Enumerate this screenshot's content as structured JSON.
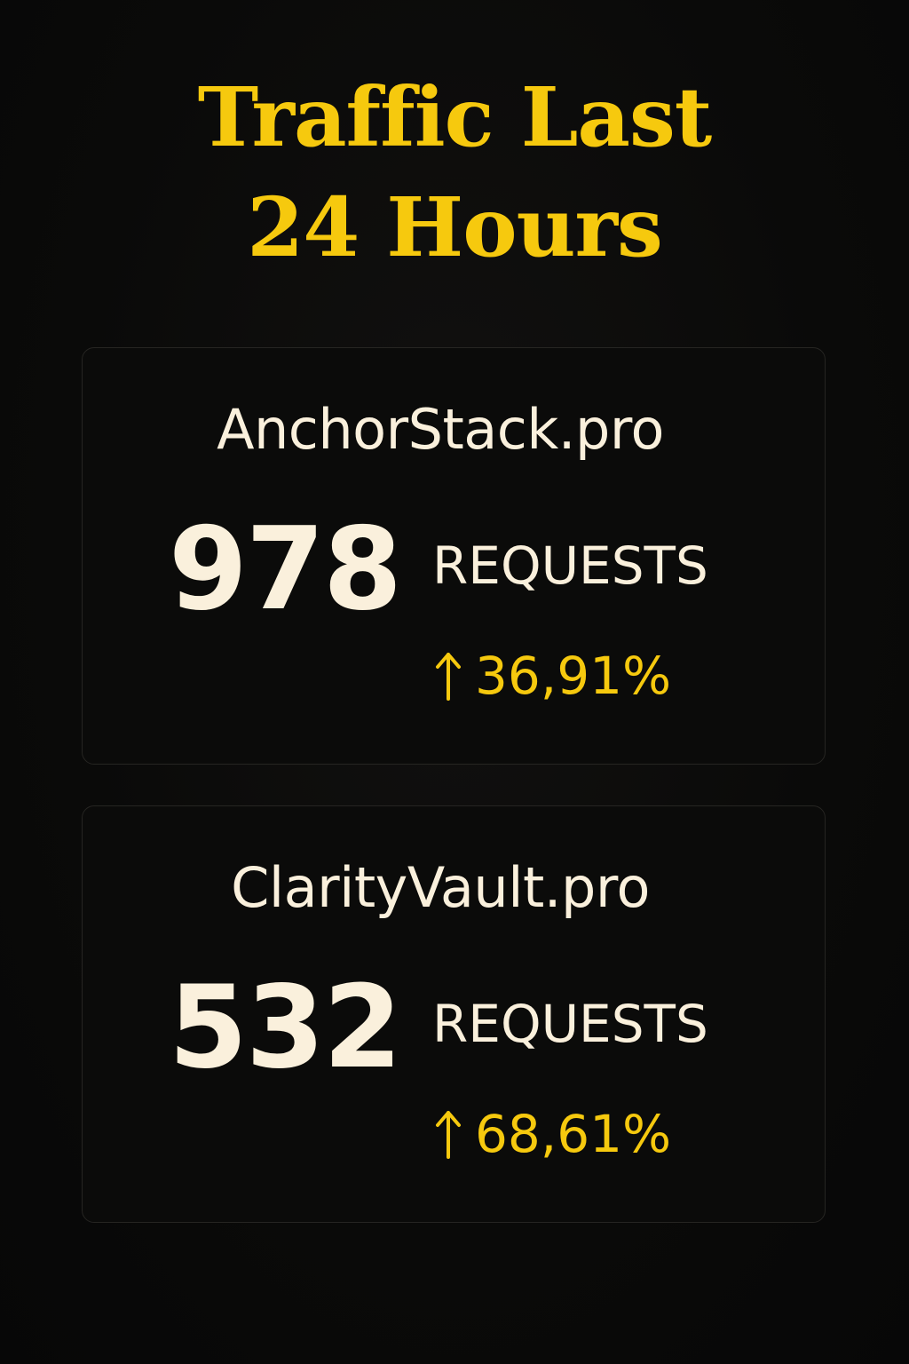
{
  "title": {
    "line1": "Traffic Last",
    "line2": "24 Hours"
  },
  "colors": {
    "accent": "#f6c90e",
    "text": "#faf0dc",
    "background": "#0a0a09",
    "card_border": "#262522"
  },
  "cards": [
    {
      "domain": "AnchorStack.pro",
      "count": "978",
      "unit": "REQUESTS",
      "change_icon": "arrow-up-icon",
      "change": "36,91%"
    },
    {
      "domain": "ClarityVault.pro",
      "count": "532",
      "unit": "REQUESTS",
      "change_icon": "arrow-up-icon",
      "change": "68,61%"
    }
  ]
}
